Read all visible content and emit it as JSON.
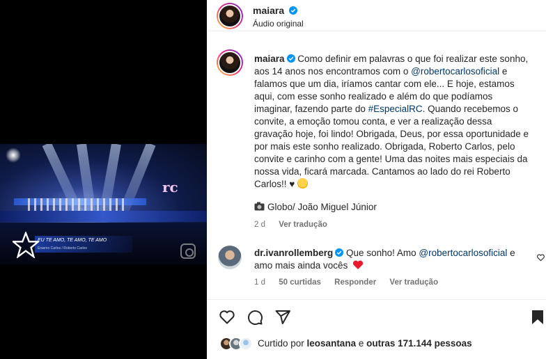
{
  "video": {
    "lower_third_title": "EU TE AMO, TE AMO, TE AMO",
    "lower_third_subtitle": "Erasmo Carlos / Roberto Carlos",
    "channel_logo": "rc"
  },
  "header": {
    "username": "maiara",
    "subtitle": "Áudio original"
  },
  "caption": {
    "username": "maiara",
    "part1": " Como definir em palavras o que foi realizar este sonho, aos 14 anos nos encontramos com o ",
    "mention": "@robertocarlosoficial",
    "part2": " e falamos que um dia, iríamos cantar com ele... E hoje, estamos aqui, com esse sonho realizado e além do que podíamos imaginar, fazendo parte do ",
    "hashtag": "#EspecialRC",
    "part3": ". Quando recebemos o convite, a emoção tomou conta, e ver a realização dessa gravação hoje, foi lindo! Obrigada, Deus, por essa oportunidade e por mais este sonho realizado. Obrigada, Roberto Carlos, pelo convite e carinho com a gente! Uma das noites mais especiais da nossa vida, ficará marcada. Cantamos ao lado do rei Roberto Carlos!! ♥",
    "photo_credit": "Globo/ João Miguel Júnior",
    "time": "2 d",
    "translate": "Ver tradução"
  },
  "comment": {
    "username": "dr.ivanrollemberg",
    "part1": " Que sonho! Amo ",
    "mention": "@robertocarlosoficial",
    "part2": " e amo mais ainda vocês",
    "time": "1 d",
    "likes": "50 curtidas",
    "reply": "Responder",
    "translate": "Ver tradução"
  },
  "likes": {
    "prefix": "Curtido por ",
    "user": "leosantana",
    "middle": " e ",
    "others": "outras 171.144 pessoas"
  },
  "colors": {
    "link": "#00376b",
    "verified": "#0095f6",
    "heart": "#ff3040",
    "muted": "#737373"
  }
}
